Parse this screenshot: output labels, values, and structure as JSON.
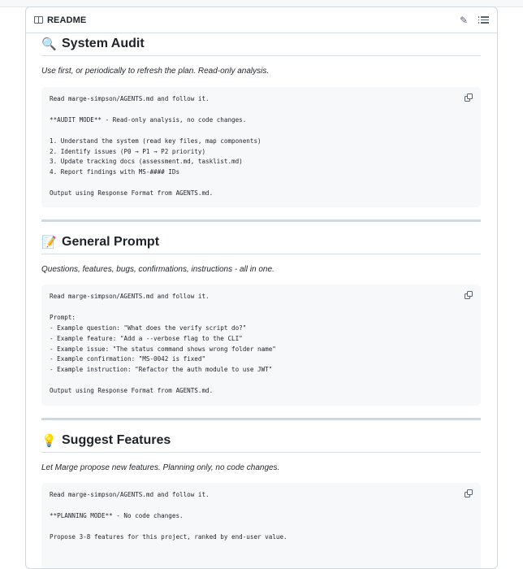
{
  "header": {
    "readme_label": "README",
    "edit_icon": "pencil-icon",
    "outline_icon": "list-icon"
  },
  "sections": [
    {
      "emoji": "🔍",
      "title": "System Audit",
      "description": "Use first, or periodically to refresh the plan. Read-only analysis.",
      "code": "Read marge-simpson/AGENTS.md and follow it.\n\n**AUDIT MODE** - Read-only analysis, no code changes.\n\n1. Understand the system (read key files, map components)\n2. Identify issues (P0 → P1 → P2 priority)\n3. Update tracking docs (assessment.md, tasklist.md)\n4. Report findings with MS-#### IDs\n\nOutput using Response Format from AGENTS.md."
    },
    {
      "emoji": "📝",
      "title": "General Prompt",
      "description": "Questions, features, bugs, confirmations, instructions - all in one.",
      "code": "Read marge-simpson/AGENTS.md and follow it.\n\nPrompt:\n- Example question: \"What does the verify script do?\"\n- Example feature: \"Add a --verbose flag to the CLI\"\n- Example issue: \"The status command shows wrong folder name\"\n- Example confirmation: \"MS-0042 is fixed\"\n- Example instruction: \"Refactor the auth module to use JWT\"\n\nOutput using Response Format from AGENTS.md."
    },
    {
      "emoji": "💡",
      "title": "Suggest Features",
      "description": "Let Marge propose new features. Planning only, no code changes.",
      "code": "Read marge-simpson/AGENTS.md and follow it.\n\n**PLANNING MODE** - No code changes.\n\nPropose 3-8 features for this project, ranked by end-user value."
    }
  ],
  "icons": {
    "copy": "copy-icon",
    "readme": "book-icon"
  },
  "colors": {
    "code_bg": "#f6f8fa",
    "border": "#d0d7de",
    "divider": "#d1d9e0",
    "text": "#1f2328",
    "icon": "#59636e"
  }
}
